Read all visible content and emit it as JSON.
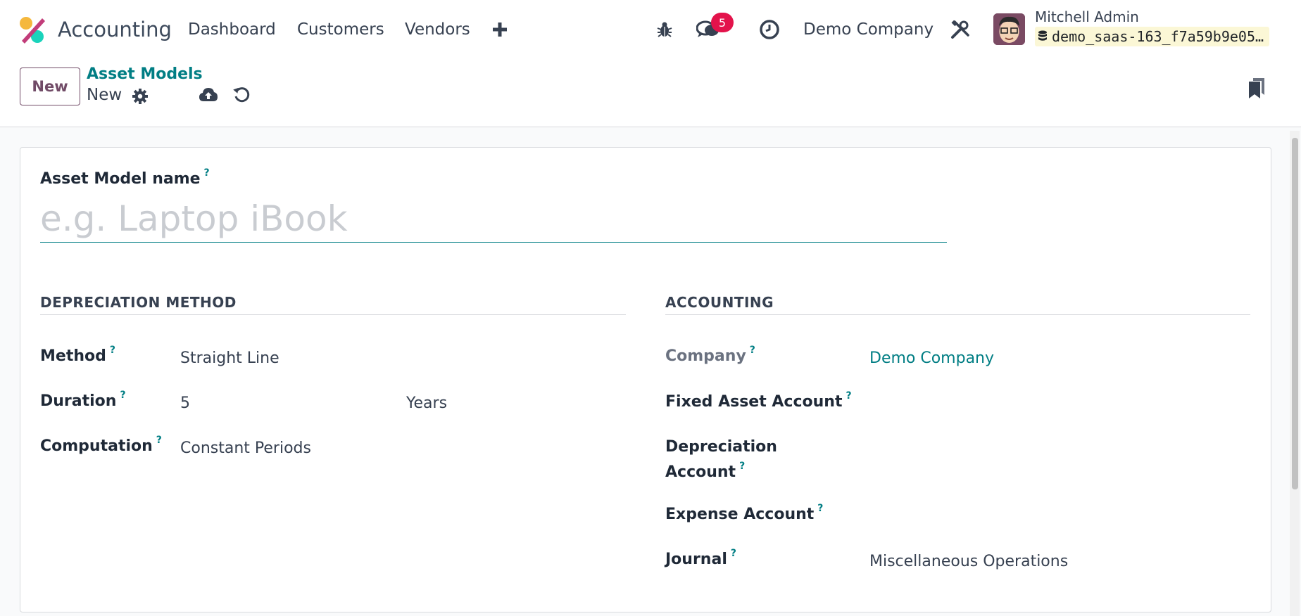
{
  "navbar": {
    "app_name": "Accounting",
    "menu": [
      "Dashboard",
      "Customers",
      "Vendors"
    ],
    "messages_count": "5",
    "company": "Demo Company",
    "user_name": "Mitchell Admin",
    "database": "demo_saas-163_f7a59b9e05…",
    "icons": [
      "apps-logo-icon",
      "plus-icon",
      "bug-icon",
      "chat-icon",
      "clock-icon",
      "tools-icon",
      "database-icon"
    ]
  },
  "control_panel": {
    "new_label": "New",
    "breadcrumb_parent": "Asset Models",
    "breadcrumb_current": "New",
    "icons": [
      "gear-icon",
      "cloud-upload-icon",
      "discard-icon",
      "bookmark-icon"
    ]
  },
  "form": {
    "name_label": "Asset Model name",
    "name_placeholder": "e.g. Laptop iBook",
    "help_mark": "?",
    "depreciation": {
      "title": "DEPRECIATION METHOD",
      "method_label": "Method",
      "method_value": "Straight Line",
      "duration_label": "Duration",
      "duration_value": "5",
      "duration_unit": "Years",
      "computation_label": "Computation",
      "computation_value": "Constant Periods"
    },
    "accounting": {
      "title": "ACCOUNTING",
      "company_label": "Company",
      "company_value": "Demo Company",
      "fixed_asset_label": "Fixed Asset Account",
      "depreciation_label_1": "Depreciation",
      "depreciation_label_2": "Account",
      "expense_label": "Expense Account",
      "journal_label": "Journal",
      "journal_value": "Miscellaneous Operations"
    }
  },
  "colors": {
    "brand": "#714b67",
    "link": "#017e84",
    "badge": "#e3134b"
  }
}
